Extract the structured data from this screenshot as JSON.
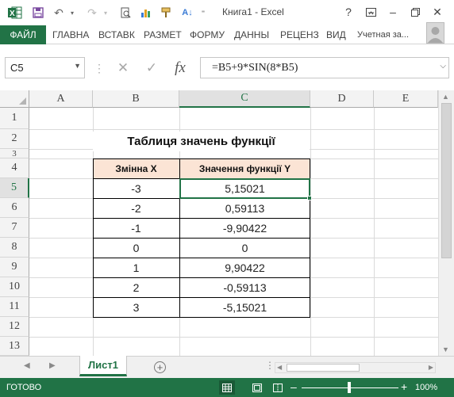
{
  "window": {
    "title": "Книга1 - Excel"
  },
  "ribbon": {
    "file_tab": "ФАЙЛ",
    "tabs": [
      "ГЛАВНА",
      "ВСТАВК",
      "РАЗМЕТ",
      "ФОРМУ",
      "ДАННЫ",
      "РЕЦЕНЗ",
      "ВИД"
    ],
    "account": "Учетная за..."
  },
  "formula_bar": {
    "name_box": "C5",
    "fx_label": "fx",
    "formula": "=B5+9*SIN(8*B5)"
  },
  "grid": {
    "columns": [
      "A",
      "B",
      "C",
      "D",
      "E"
    ],
    "selected_column": "C",
    "rows": [
      "1",
      "2",
      "3",
      "4",
      "5",
      "6",
      "7",
      "8",
      "9",
      "10",
      "11",
      "12",
      "13"
    ],
    "selected_row": "5",
    "table_title": "Таблиця значень функції",
    "table_headers": [
      "Змінна X",
      "Значення функції Y"
    ],
    "table_rows": [
      {
        "x": "-3",
        "y": "5,15021"
      },
      {
        "x": "-2",
        "y": "0,59113"
      },
      {
        "x": "-1",
        "y": "-9,90422"
      },
      {
        "x": "0",
        "y": "0"
      },
      {
        "x": "1",
        "y": "9,90422"
      },
      {
        "x": "2",
        "y": "-0,59113"
      },
      {
        "x": "3",
        "y": "-5,15021"
      }
    ]
  },
  "sheets": {
    "active": "Лист1"
  },
  "status": {
    "ready": "ГОТОВО",
    "zoom": "100%"
  },
  "colors": {
    "accent": "#217346",
    "header_fill": "#fbe4d5"
  }
}
